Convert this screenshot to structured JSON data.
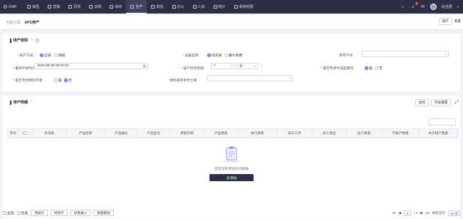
{
  "nav": {
    "logo": "GMP",
    "items": [
      {
        "label": "销售",
        "icon": "sales-icon"
      },
      {
        "label": "营销",
        "icon": "marketing-icon"
      },
      {
        "label": "研发",
        "icon": "rd-icon"
      },
      {
        "label": "采购",
        "icon": "purchase-icon"
      },
      {
        "label": "库存",
        "icon": "inventory-icon"
      },
      {
        "label": "生产",
        "icon": "production-icon",
        "active": true
      },
      {
        "label": "财务",
        "icon": "finance-icon"
      },
      {
        "label": "办公",
        "icon": "office-icon"
      },
      {
        "label": "人资",
        "icon": "hr-icon"
      },
      {
        "label": "统计",
        "icon": "stats-icon"
      },
      {
        "label": "系统管理",
        "icon": "system-icon"
      }
    ],
    "notification_count": "2",
    "username": "赵佳惠"
  },
  "breadcrumb": {
    "label": "当前位置:",
    "current": "APS排产",
    "actions": [
      "排产",
      "重置"
    ]
  },
  "form": {
    "title": "排产规则",
    "sort_method_label": "排产方式:",
    "sort_options": [
      "正排",
      "倒排"
    ],
    "device_label": "设备选用:",
    "device_options": [
      "优先级",
      "最大效用"
    ],
    "ref_label": "参考产线:",
    "start_label": "最早开始时间:",
    "start_value": "2025-08-08 08:00:00",
    "range_label": "排产时间范围:",
    "range_value": "7",
    "range_unit": "天",
    "consider_label": "是否考虑半成品库存:",
    "consider_options": [
      "是",
      "否"
    ],
    "material_label": "是否考虑物料齐套:",
    "material_options": [
      "是",
      "否"
    ],
    "material_ref_label": "物料库存参考仓库:"
  },
  "table": {
    "title": "排产明细",
    "actions": [
      "查找",
      "列宽重置"
    ],
    "columns": [
      "序号",
      "",
      "优先级",
      "产品名称",
      "产品编号",
      "产品型号",
      "单据于期",
      "产品数量",
      "执行部库",
      "加工工序",
      "加工类型",
      "加工数量",
      "可排产数量",
      "本次排产数量"
    ],
    "empty_text": "您还没有添加任何数据",
    "add_label": "去添加"
  },
  "footer": {
    "buttons": [
      "全选",
      "反选",
      "添加行",
      "修改行",
      "批量录入",
      "批量删除"
    ],
    "page_current": "0",
    "page_total": "/ 0",
    "page_size_label": "每页显示",
    "page_size": "10 条"
  }
}
